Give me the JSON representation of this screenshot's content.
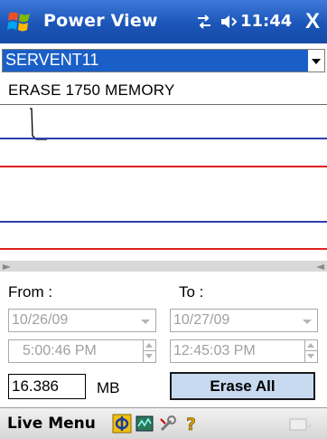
{
  "titlebar": {
    "title": "Power View",
    "time": "11:44",
    "close_label": "X",
    "icons": [
      "windows-flag-icon",
      "connectivity-icon",
      "volume-icon"
    ]
  },
  "device": {
    "selected": "SERVENT11"
  },
  "section": {
    "label": "ERASE 1750 MEMORY"
  },
  "graph": {
    "colors": {
      "blue": "#2b3fb0",
      "red": "#e02020"
    }
  },
  "range": {
    "from_label": "From :",
    "to_label": "To :",
    "from_date": "10/26/09",
    "to_date": "10/27/09",
    "from_time": "5:00:46 PM",
    "to_time": "12:45:03 PM"
  },
  "memory": {
    "value": "16.386",
    "unit": "MB"
  },
  "actions": {
    "erase_all": "Erase All"
  },
  "menubar": {
    "label": "Live Menu",
    "icons": [
      "phi-icon",
      "chart-icon",
      "wrench-icon",
      "help-icon",
      "keyboard-icon"
    ],
    "help_glyph": "?"
  }
}
